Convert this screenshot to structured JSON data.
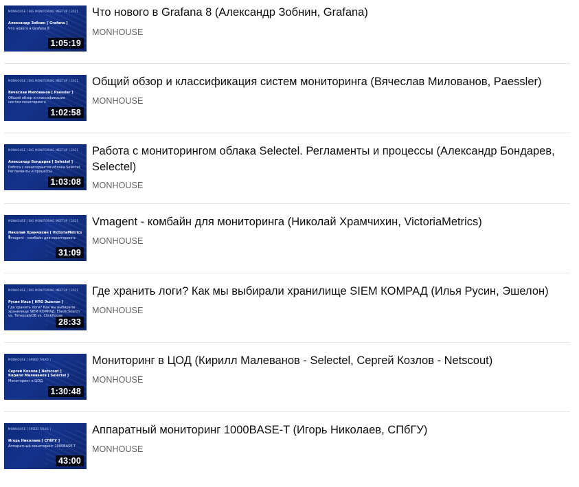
{
  "videos": [
    {
      "title": "Что нового в Grafana 8 (Александр Зобнин, Grafana)",
      "channel": "MONHOUSE",
      "duration": "1:05:19",
      "thumb_brand": "MONHOUSE [ BIG MONITORING MEETUP ] 2021",
      "thumb_speaker": "Александр Зобнин [ Grafana ]",
      "thumb_topic": "Что нового в Grafana 8"
    },
    {
      "title": "Общий обзор и классификация систем мониторинга (Вячеслав Милованов, Paessler)",
      "channel": "MONHOUSE",
      "duration": "1:02:58",
      "thumb_brand": "MONHOUSE [ BIG MONITORING MEETUP ] 2021",
      "thumb_speaker": "Вячеслав Милованов [ Paessler ]",
      "thumb_topic": "Общий обзор и классификация\nсистем мониторинга"
    },
    {
      "title": "Работа с мониторингом облака Selectel. Регламенты и процессы (Александр Бондарев, Selectel)",
      "channel": "MONHOUSE",
      "duration": "1:03:08",
      "thumb_brand": "MONHOUSE [ BIG MONITORING MEETUP ] 2021",
      "thumb_speaker": "Александр Бондарев [ Selectel ]",
      "thumb_topic": "Работа с мониторингом облака Selectel.\nРегламенты и процессы"
    },
    {
      "title": "Vmagent - комбайн для мониторинга (Николай Храмчихин, VictoriaMetrics)",
      "channel": "MONHOUSE",
      "duration": "31:09",
      "thumb_brand": "MONHOUSE [ BIG MONITORING MEETUP ] 2021",
      "thumb_speaker": "Николай Храмчихин [ VictoriaMetrics ]",
      "thumb_topic": "Vmagent - комбайн для мониторинга"
    },
    {
      "title": "Где хранить логи? Как мы выбирали хранилище SIEM КОМРАД (Илья Русин, Эшелон)",
      "channel": "MONHOUSE",
      "duration": "28:33",
      "thumb_brand": "MONHOUSE [ BIG MONITORING MEETUP ] 2021",
      "thumb_speaker": "Русин Илья [ НПО Эшелон ]",
      "thumb_topic": "Где хранить логи? Как мы выбирали\nхранилище SIEM КОМРАД: ElasticSearch\nvs. TimescaleDB vs. ClickHouse"
    },
    {
      "title": "Мониторинг в ЦОД (Кирилл Малеванов - Selectel, Сергей Козлов - Netscout)",
      "channel": "MONHOUSE",
      "duration": "1:30:48",
      "thumb_brand": "MONHOUSE [ SPEED TALKS ]",
      "thumb_speaker": "Сергей Козлов [ Netscout ]\nКирилл Малеванов [ Selectel ]",
      "thumb_topic": "Мониторинг в ЦОД"
    },
    {
      "title": "Аппаратный мониторинг 1000BASE-T (Игорь Николаев, СПбГУ)",
      "channel": "MONHOUSE",
      "duration": "43:00",
      "thumb_brand": "MONHOUSE [ SPEED TALKS ]",
      "thumb_speaker": "Игорь Николаев [ СПбГУ ]",
      "thumb_topic": "Аппаратный мониторинг 1000BASE-T"
    }
  ]
}
